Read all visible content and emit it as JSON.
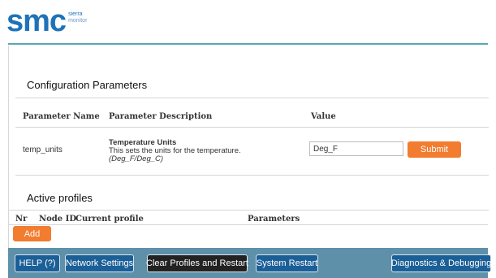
{
  "brand": {
    "logo_text": "smc",
    "logo_sub_1": "sierra",
    "logo_sub_2": "monitor",
    "primary_color": "#1e73b8",
    "accent_color": "#f27c2f",
    "footer_color": "#5e90aa"
  },
  "config": {
    "title": "Configuration Parameters",
    "headers": {
      "name": "Parameter Name",
      "description": "Parameter Description",
      "value": "Value"
    },
    "rows": [
      {
        "name": "temp_units",
        "desc_title": "Temperature Units",
        "desc_text": "This sets the units for the temperature.",
        "desc_options": "(Deg_F/Deg_C)",
        "value": "Deg_F",
        "submit_label": "Submit"
      }
    ]
  },
  "profiles": {
    "title": "Active profiles",
    "headers": {
      "nr": "Nr",
      "node_id": "Node ID",
      "current_profile": "Current profile",
      "parameters": "Parameters"
    },
    "add_label": "Add"
  },
  "footer": {
    "help": "HELP (?)",
    "network_settings": "Network Settings",
    "clear_profiles": "Clear Profiles and Restart",
    "system_restart": "System Restart",
    "diagnostics": "Diagnostics & Debugging"
  }
}
